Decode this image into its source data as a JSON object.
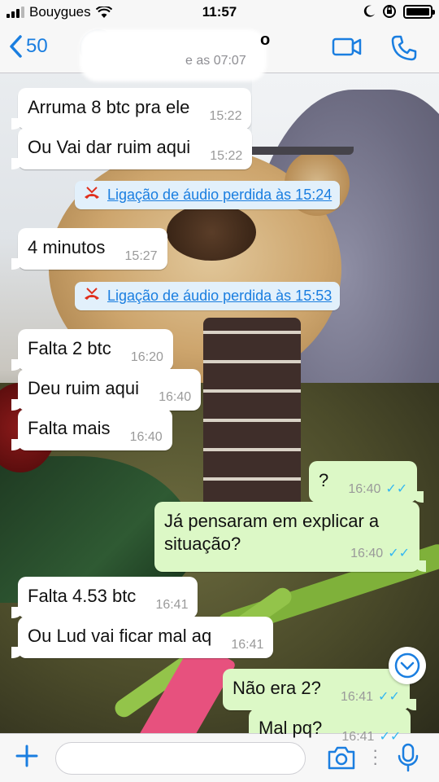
{
  "status_bar": {
    "carrier": "Bouygues",
    "time": "11:57"
  },
  "header": {
    "back_count": "50",
    "subtitle": "e as 07:07",
    "name_tail": "o"
  },
  "messages": [
    {
      "type": "in",
      "text": "Arruma 8 btc pra ele",
      "time": "15:22"
    },
    {
      "type": "in",
      "text": "Ou Vai dar ruim aqui",
      "time": "15:22"
    },
    {
      "type": "system",
      "text": "Ligação de áudio perdida às 15:24"
    },
    {
      "type": "in",
      "text": "4 minutos",
      "time": "15:27"
    },
    {
      "type": "system",
      "text": "Ligação de áudio perdida às 15:53"
    },
    {
      "type": "in",
      "text": "Falta 2 btc",
      "time": "16:20"
    },
    {
      "type": "in",
      "text": "Deu ruim aqui",
      "time": "16:40"
    },
    {
      "type": "in",
      "text": "Falta mais",
      "time": "16:40"
    },
    {
      "type": "out",
      "text": "?",
      "time": "16:40"
    },
    {
      "type": "out",
      "text": "Já pensaram em explicar a situação?",
      "time": "16:40"
    },
    {
      "type": "in",
      "text": "Falta 4.53 btc",
      "time": "16:41"
    },
    {
      "type": "in",
      "text": "Ou Lud vai ficar mal aq",
      "time": "16:41"
    },
    {
      "type": "out",
      "text": "Não era 2?",
      "time": "16:41"
    },
    {
      "type": "out",
      "text": "Mal pq?",
      "time": "16:41"
    }
  ],
  "input": {
    "placeholder": ""
  },
  "colors": {
    "accent": "#1a7ee0",
    "outgoing_bubble": "#dcf8c6",
    "incoming_bubble": "#ffffff",
    "read_ticks": "#34b7f1",
    "missed_call": "#e0301e"
  },
  "icons": {
    "back": "chevron-left-icon",
    "video": "video-camera-icon",
    "call": "phone-icon",
    "missed_call": "missed-call-icon",
    "read": "double-check-icon",
    "scroll": "chevron-down-icon",
    "attach": "plus-icon",
    "camera": "camera-icon",
    "mic": "microphone-icon"
  }
}
